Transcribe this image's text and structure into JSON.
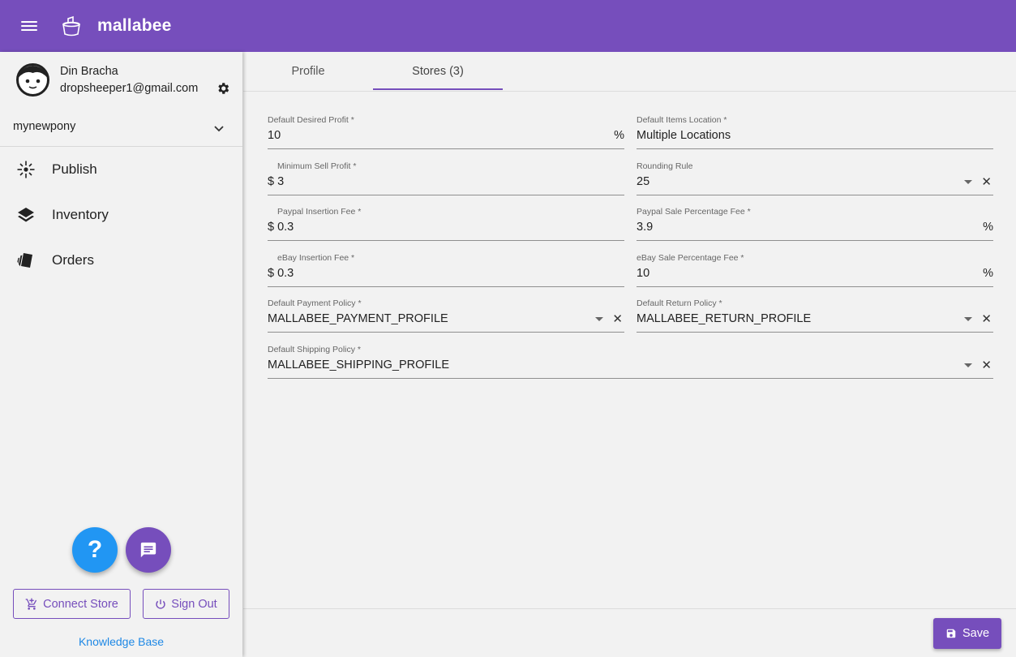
{
  "app": {
    "brand": "mallabee",
    "accent": "#764ebc",
    "link_color": "#1e88e5",
    "help_color": "#2196f3"
  },
  "user": {
    "name": "Din Bracha",
    "email": "dropsheeper1@gmail.com"
  },
  "store_selector": {
    "value": "mynewpony"
  },
  "nav": [
    {
      "label": "Publish",
      "icon": "publish-icon"
    },
    {
      "label": "Inventory",
      "icon": "layers-icon"
    },
    {
      "label": "Orders",
      "icon": "cards-icon"
    }
  ],
  "help_fab": {
    "glyph": "?"
  },
  "buttons": {
    "connect_store": "Connect Store",
    "sign_out": "Sign Out",
    "save": "Save"
  },
  "knowledge_base": "Knowledge Base",
  "tabs": [
    {
      "label": "Profile",
      "active": false
    },
    {
      "label": "Stores (3)",
      "active": true
    }
  ],
  "form": {
    "default_desired_profit": {
      "label": "Default Desired Profit *",
      "value": "10",
      "suffix": "%"
    },
    "default_items_location": {
      "label": "Default Items Location *",
      "value": "Multiple Locations"
    },
    "minimum_sell_profit": {
      "label": "Minimum Sell Profit *",
      "value": "$ 3"
    },
    "rounding_rule": {
      "label": "Rounding Rule",
      "value": "25"
    },
    "paypal_insertion_fee": {
      "label": "Paypal Insertion Fee *",
      "value": "$ 0.3"
    },
    "paypal_sale_percentage_fee": {
      "label": "Paypal Sale Percentage Fee *",
      "value": "3.9",
      "suffix": "%"
    },
    "ebay_insertion_fee": {
      "label": "eBay Insertion Fee *",
      "value": "$ 0.3"
    },
    "ebay_sale_percentage_fee": {
      "label": "eBay Sale Percentage Fee *",
      "value": "10",
      "suffix": "%"
    },
    "default_payment_policy": {
      "label": "Default Payment Policy *",
      "value": "MALLABEE_PAYMENT_PROFILE"
    },
    "default_return_policy": {
      "label": "Default Return Policy *",
      "value": "MALLABEE_RETURN_PROFILE"
    },
    "default_shipping_policy": {
      "label": "Default Shipping Policy *",
      "value": "MALLABEE_SHIPPING_PROFILE"
    }
  }
}
